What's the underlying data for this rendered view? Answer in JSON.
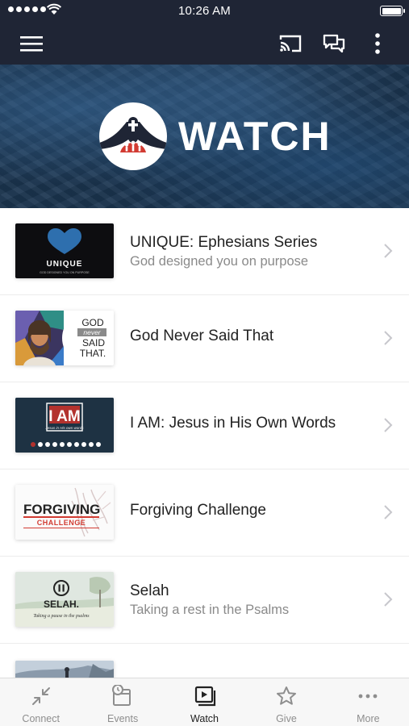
{
  "status_bar": {
    "time": "10:26 AM",
    "battery_level": 1.0
  },
  "app_bar": {
    "icons": [
      "menu-icon",
      "cast-icon",
      "chat-icon",
      "more-vertical-icon"
    ]
  },
  "hero": {
    "title": "WATCH"
  },
  "list": {
    "items": [
      {
        "title": "UNIQUE: Ephesians Series",
        "subtitle": "God designed you on purpose",
        "thumb_text": "UNIQUE",
        "thumb_caption": "GOD DESIGNED YOU ON PURPOSE"
      },
      {
        "title": "God Never Said That",
        "subtitle": "",
        "thumb_lines": [
          "GOD",
          "never",
          "SAID",
          "THAT."
        ]
      },
      {
        "title": "I AM: Jesus in His Own Words",
        "subtitle": "",
        "thumb_text": "I AM",
        "thumb_caption": "Jesus in His own words"
      },
      {
        "title": "Forgiving Challenge",
        "subtitle": "",
        "thumb_text": "FORGIVING",
        "thumb_caption": "CHALLENGE"
      },
      {
        "title": "Selah",
        "subtitle": "Taking a rest in the Psalms",
        "thumb_text": "SELAH.",
        "thumb_caption": "Taking a pause in the psalms"
      }
    ]
  },
  "tabs": [
    {
      "label": "Connect",
      "icon": "connect-icon",
      "active": false
    },
    {
      "label": "Events",
      "icon": "events-icon",
      "active": false
    },
    {
      "label": "Watch",
      "icon": "watch-icon",
      "active": true
    },
    {
      "label": "Give",
      "icon": "star-icon",
      "active": false
    },
    {
      "label": "More",
      "icon": "more-horizontal-icon",
      "active": false
    }
  ],
  "colors": {
    "header_bg": "#1f2535",
    "hero_bg": "#1b3550",
    "accent_red": "#d23b32",
    "tab_active": "#222222",
    "tab_inactive": "#8e8e8e"
  }
}
